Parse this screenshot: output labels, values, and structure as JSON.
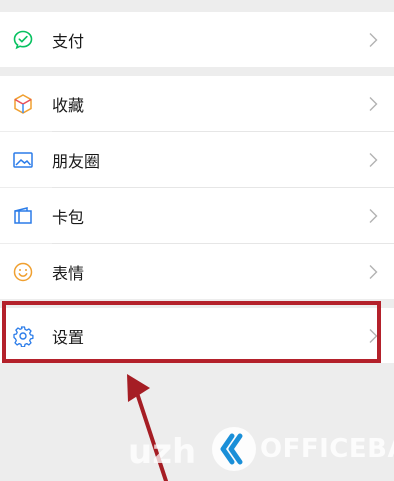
{
  "menu": {
    "pay_label": "支付",
    "favorites_label": "收藏",
    "moments_label": "朋友圈",
    "cards_label": "卡包",
    "stickers_label": "表情",
    "settings_label": "设置"
  },
  "watermark": {
    "left_text": "uzh",
    "right_text": "OFFICEBA"
  },
  "colors": {
    "pay_green": "#07c160",
    "highlight_red": "#b4212b",
    "arrow_red": "#a51d24"
  }
}
